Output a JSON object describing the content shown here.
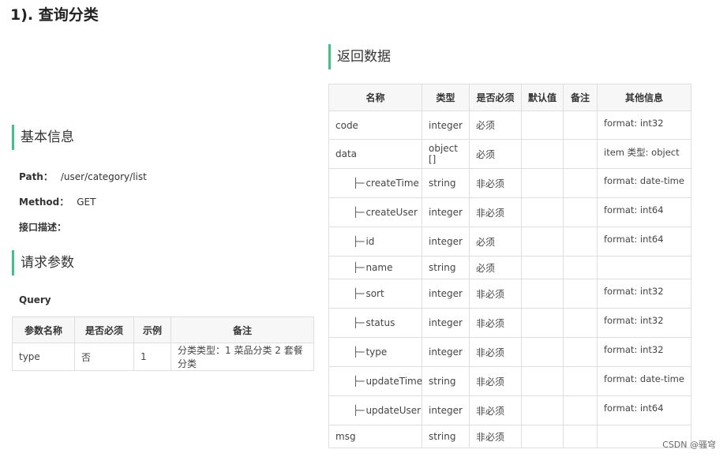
{
  "page_title": "1). 查询分类",
  "basic_info": {
    "heading": "基本信息",
    "path_label": "Path：",
    "path_value": "/user/category/list",
    "method_label": "Method：",
    "method_value": "GET",
    "desc_label": "接口描述："
  },
  "request_params": {
    "heading": "请求参数",
    "query_label": "Query",
    "columns": [
      "参数名称",
      "是否必须",
      "示例",
      "备注"
    ],
    "rows": [
      {
        "name": "type",
        "required": "否",
        "example": "1",
        "note": "分类类型：1 菜品分类 2 套餐分类"
      }
    ]
  },
  "response": {
    "heading": "返回数据",
    "columns": [
      "名称",
      "类型",
      "是否必须",
      "默认值",
      "备注",
      "其他信息"
    ],
    "rows": [
      {
        "name": "code",
        "child": false,
        "type": "integer",
        "required": "必须",
        "default": "",
        "note": "",
        "other": "format: int32"
      },
      {
        "name": "data",
        "child": false,
        "type": "object []",
        "required": "必须",
        "default": "",
        "note": "",
        "other": "item 类型: object"
      },
      {
        "name": "createTime",
        "child": true,
        "type": "string",
        "required": "非必须",
        "default": "",
        "note": "",
        "other": "format: date-time"
      },
      {
        "name": "createUser",
        "child": true,
        "type": "integer",
        "required": "非必须",
        "default": "",
        "note": "",
        "other": "format: int64"
      },
      {
        "name": "id",
        "child": true,
        "type": "integer",
        "required": "必须",
        "default": "",
        "note": "",
        "other": "format: int64"
      },
      {
        "name": "name",
        "child": true,
        "type": "string",
        "required": "必须",
        "default": "",
        "note": "",
        "other": ""
      },
      {
        "name": "sort",
        "child": true,
        "type": "integer",
        "required": "非必须",
        "default": "",
        "note": "",
        "other": "format: int32"
      },
      {
        "name": "status",
        "child": true,
        "type": "integer",
        "required": "非必须",
        "default": "",
        "note": "",
        "other": "format: int32"
      },
      {
        "name": "type",
        "child": true,
        "type": "integer",
        "required": "非必须",
        "default": "",
        "note": "",
        "other": "format: int32"
      },
      {
        "name": "updateTime",
        "child": true,
        "type": "string",
        "required": "非必须",
        "default": "",
        "note": "",
        "other": "format: date-time"
      },
      {
        "name": "updateUser",
        "child": true,
        "type": "integer",
        "required": "非必须",
        "default": "",
        "note": "",
        "other": "format: int64"
      },
      {
        "name": "msg",
        "child": false,
        "type": "string",
        "required": "非必须",
        "default": "",
        "note": "",
        "other": ""
      }
    ]
  },
  "tree_glyph": "├─",
  "watermark": "CSDN @骚穹",
  "colors": {
    "accent": "#42c08a",
    "header_bg": "#f7f7f7",
    "border": "#dedede"
  }
}
